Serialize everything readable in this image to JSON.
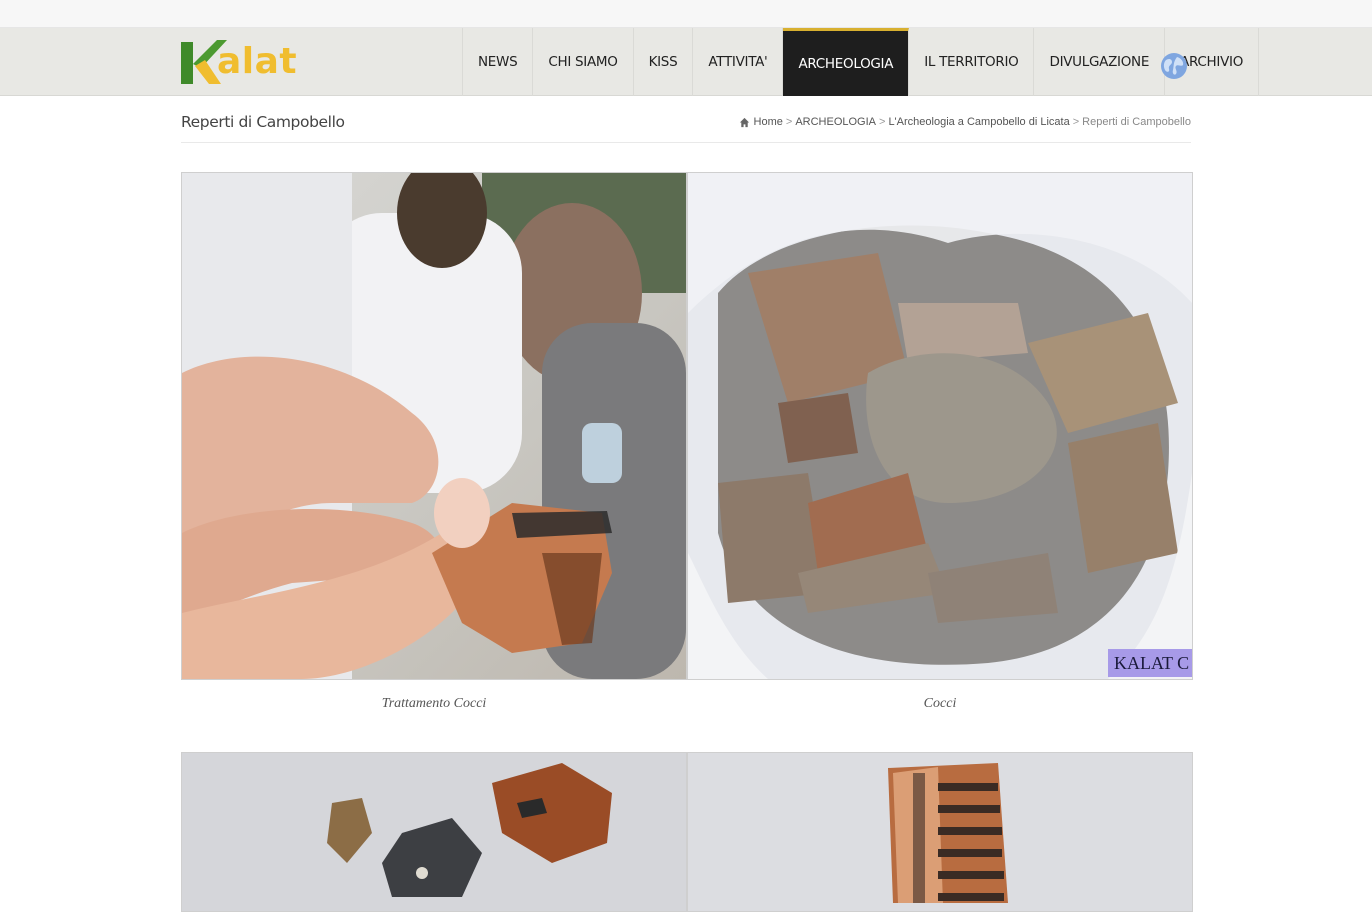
{
  "brand": {
    "logo_text_k": "K",
    "logo_text_rest": "alat",
    "colors": {
      "green": "#3f8a2a",
      "yellow": "#f0bd2f"
    }
  },
  "nav": {
    "items": [
      {
        "label": "NEWS",
        "active": false
      },
      {
        "label": "CHI SIAMO",
        "active": false
      },
      {
        "label": "KISS",
        "active": false
      },
      {
        "label": "ATTIVITA'",
        "active": false
      },
      {
        "label": "ARCHEOLOGIA",
        "active": true
      },
      {
        "label": "IL TERRITORIO",
        "active": false
      },
      {
        "label": "DIVULGAZIONE",
        "active": false
      },
      {
        "label": "ARCHIVIO",
        "active": false
      }
    ],
    "language_icon": "globe-icon",
    "accent": "#d8b030"
  },
  "page": {
    "title": "Reperti di Campobello"
  },
  "breadcrumb": {
    "home_icon": "home-icon",
    "items": [
      "Home",
      "ARCHEOLOGIA",
      "L'Archeologia a Campobello di Licata",
      "Reperti di Campobello"
    ],
    "separator": ">"
  },
  "gallery": {
    "items": [
      {
        "caption": "Trattamento Cocci"
      },
      {
        "caption": "Cocci",
        "watermark": "KALAT C"
      },
      {
        "caption": ""
      },
      {
        "caption": ""
      }
    ]
  }
}
